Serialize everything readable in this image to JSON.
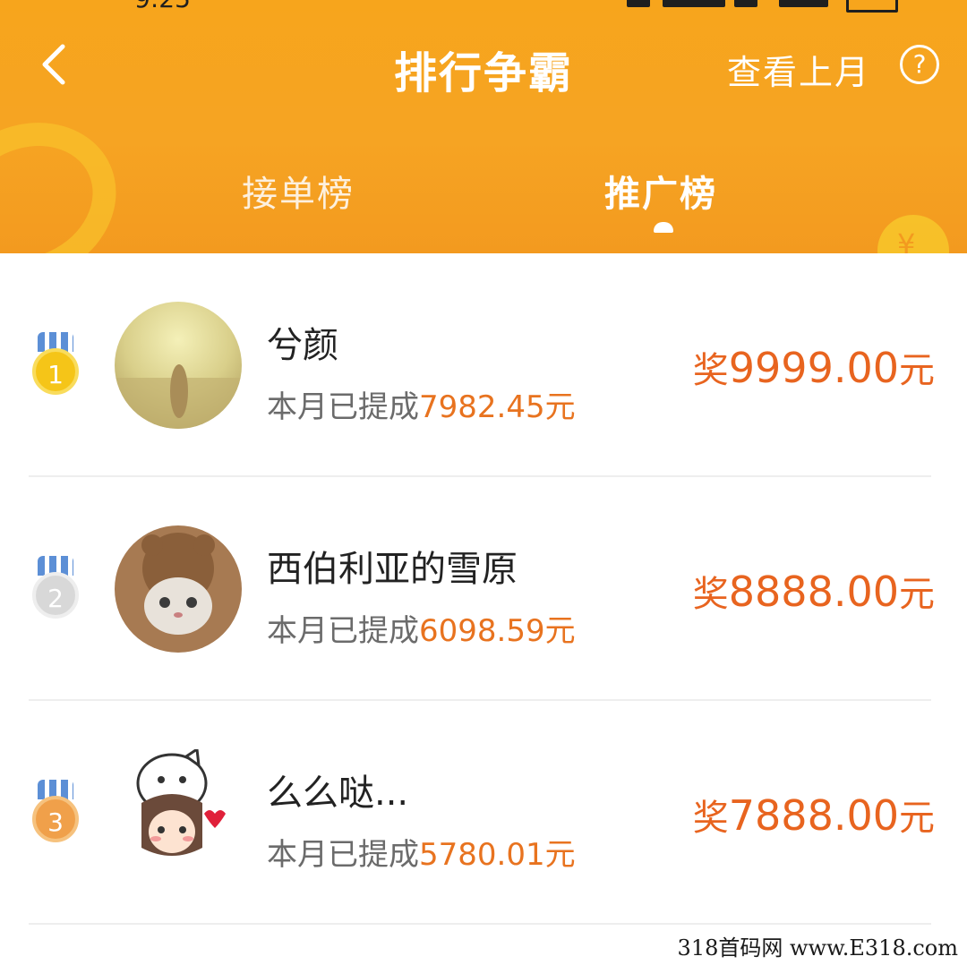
{
  "status_bar": {
    "time": "9:25"
  },
  "header": {
    "title": "排行争霸",
    "last_month": "查看上月",
    "help": "?",
    "coin": "¥"
  },
  "tabs": [
    {
      "label": "接单榜",
      "active": false
    },
    {
      "label": "推广榜",
      "active": true
    }
  ],
  "ranking": [
    {
      "rank": "1",
      "name": "兮颜",
      "earned_prefix": "本月已提成",
      "earned_amount": "7982.45元",
      "prize_prefix": "奖",
      "prize_amount": "9999.00",
      "prize_unit": "元",
      "medal": "gold"
    },
    {
      "rank": "2",
      "name": "西伯利亚的雪原",
      "earned_prefix": "本月已提成",
      "earned_amount": "6098.59元",
      "prize_prefix": "奖",
      "prize_amount": "8888.00",
      "prize_unit": "元",
      "medal": "silver"
    },
    {
      "rank": "3",
      "name": "么么哒...",
      "earned_prefix": "本月已提成",
      "earned_amount": "5780.01元",
      "prize_prefix": "奖",
      "prize_amount": "7888.00",
      "prize_unit": "元",
      "medal": "bronze"
    }
  ],
  "watermark": "318首码网 www.E318.com",
  "colors": {
    "header_orange": "#f6a423",
    "amount_orange": "#e8731f",
    "gold": "#f5c518",
    "silver": "#d8d8d8",
    "bronze": "#f0a04a"
  }
}
